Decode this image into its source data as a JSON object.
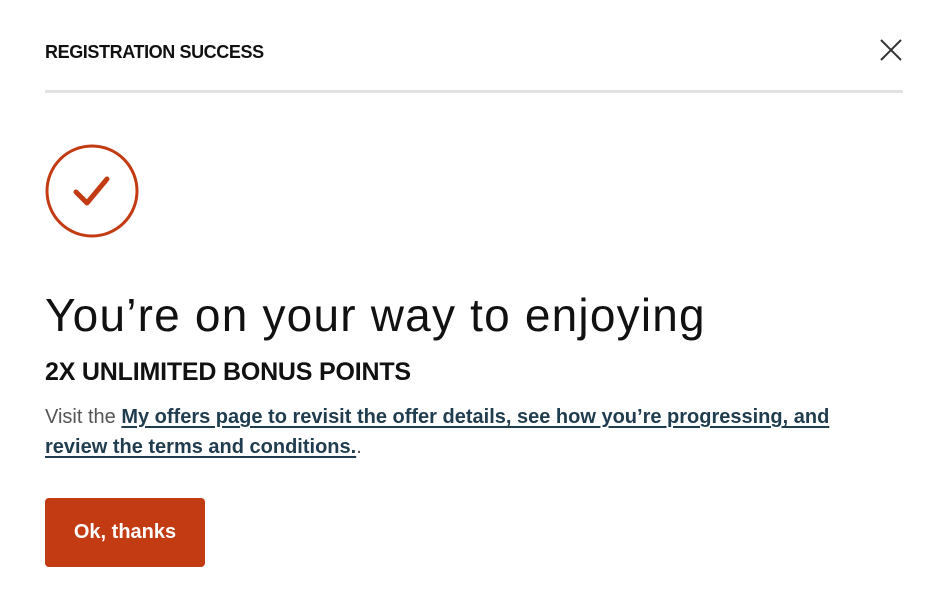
{
  "modal": {
    "title": "REGISTRATION SUCCESS",
    "close_icon": "close-icon",
    "success_icon": "checkmark-circle-icon",
    "accent_color": "#c23b13",
    "headline": "You’re on your way to enjoying",
    "offer_name": "2X UNLIMITED BONUS POINTS",
    "body_prefix": "Visit the ",
    "body_link": "My offers page to revisit the offer details, see how you’re progressing, and review the terms and conditions.",
    "body_suffix": ".",
    "ok_button_label": "Ok, thanks"
  }
}
